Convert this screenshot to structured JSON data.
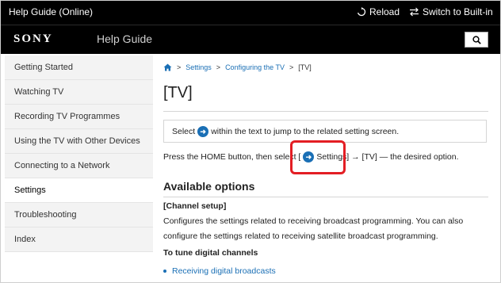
{
  "topbar": {
    "app_title": "Help Guide (Online)",
    "reload_label": "Reload",
    "switch_label": "Switch to Built-in"
  },
  "brand": {
    "logo": "SONY",
    "guide_label": "Help Guide",
    "search_icon": "search-icon"
  },
  "sidebar": {
    "items": [
      {
        "label": "Getting Started"
      },
      {
        "label": "Watching TV"
      },
      {
        "label": "Recording TV Programmes"
      },
      {
        "label": "Using the TV with Other Devices"
      },
      {
        "label": "Connecting to a Network"
      },
      {
        "label": "Settings"
      },
      {
        "label": "Troubleshooting"
      },
      {
        "label": "Index"
      }
    ],
    "active_index": 5
  },
  "breadcrumb": {
    "home_icon": "home-icon",
    "sep": ">",
    "item1": "Settings",
    "item2": "Configuring the TV",
    "item3": "[TV]"
  },
  "page": {
    "title": "[TV]",
    "note_before": "Select",
    "note_after": "within the text to jump to the related setting screen.",
    "instr_before": "Press the HOME button, then select [",
    "instr_settings": "Settings",
    "instr_after": "] → [TV] — the desired option.",
    "section_heading": "Available options",
    "subhead": "[Channel setup]",
    "para": "Configures the settings related to receiving broadcast programming. You can also configure the settings related to receiving satellite broadcast programming.",
    "tune_head": "To tune digital channels",
    "bullet_link": "Receiving digital broadcasts"
  },
  "colors": {
    "accent": "#1a6fb5",
    "highlight": "#e31e24",
    "topbar_bg": "#000000"
  }
}
